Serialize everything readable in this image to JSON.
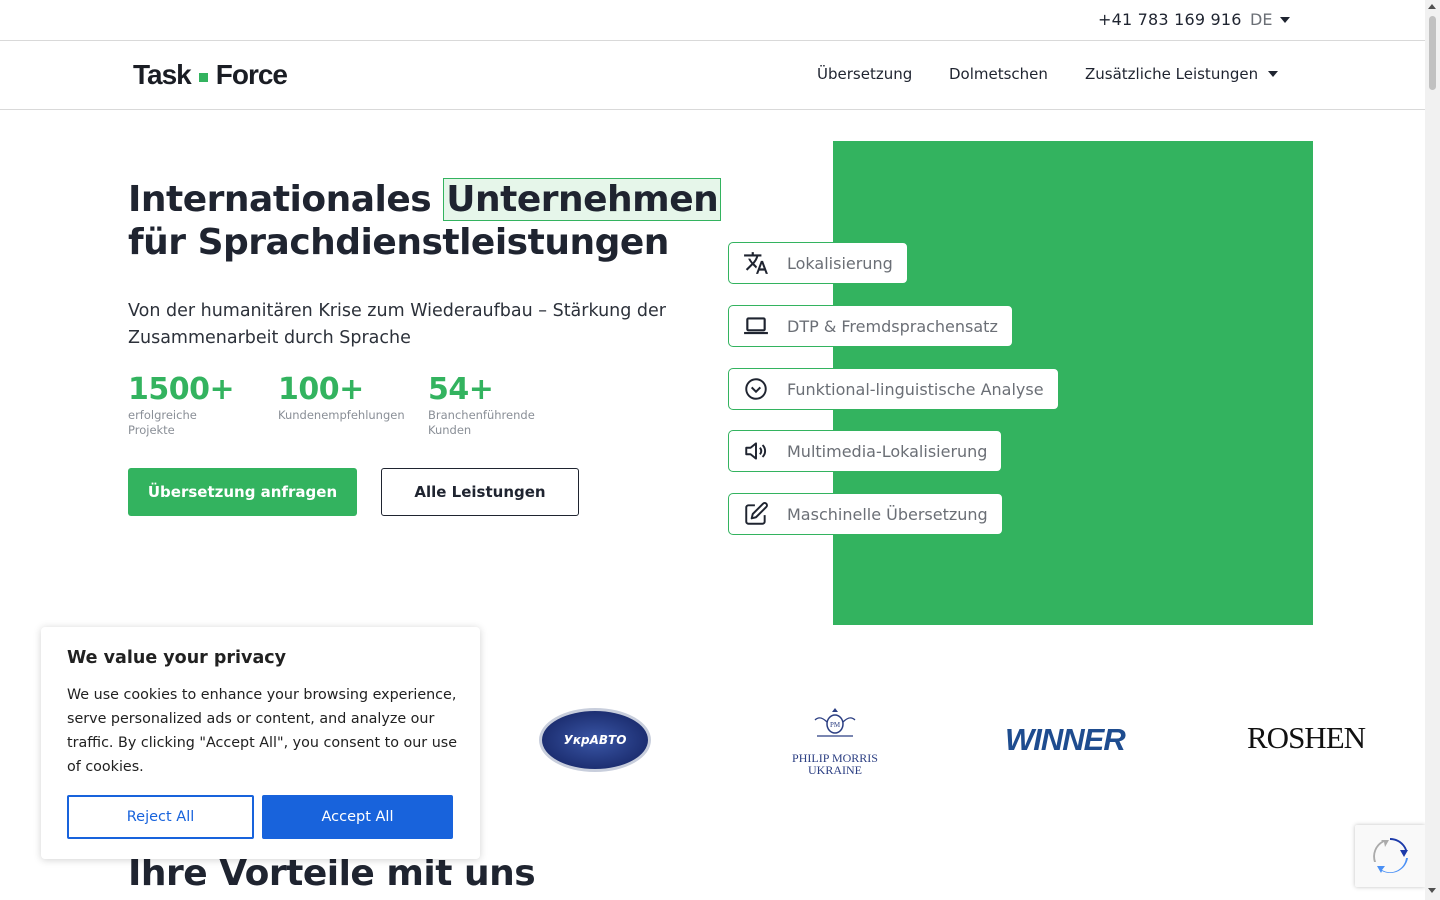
{
  "topbar": {
    "phone": "+41 783 169 916",
    "language": "DE"
  },
  "header": {
    "logo_left": "Task",
    "logo_right": "Force",
    "nav": [
      {
        "label": "Übersetzung"
      },
      {
        "label": "Dolmetschen"
      },
      {
        "label": "Zusätzliche Leistungen"
      }
    ]
  },
  "hero": {
    "title_part1": "Internationales",
    "title_highlight": "Unternehmen",
    "title_part2": "für Sprachdienstleistungen",
    "subtitle": "Von der humanitären Krise zum Wiederaufbau – Stärkung der Zusammenarbeit durch Sprache",
    "stats": [
      {
        "value": "1500+",
        "label": "erfolgreiche Projekte"
      },
      {
        "value": "100+",
        "label": "Kundenempfehlungen"
      },
      {
        "value": "54+",
        "label": "Branchenführende Kunden"
      }
    ],
    "primary_button": "Übersetzung anfragen",
    "secondary_button": "Alle Leistungen",
    "services": [
      {
        "label": "Lokalisierung",
        "icon": "translate-icon"
      },
      {
        "label": "DTP & Fremdsprachensatz",
        "icon": "laptop-icon"
      },
      {
        "label": "Funktional-linguistische Analyse",
        "icon": "chevron-circle-icon"
      },
      {
        "label": "Multimedia-Lokalisierung",
        "icon": "speaker-icon"
      },
      {
        "label": "Maschinelle Übersetzung",
        "icon": "edit-icon"
      }
    ],
    "accent_color": "#33b35f"
  },
  "clients": {
    "ukravto": "УкрАВТО",
    "philip_morris_line1": "PHILIP MORRIS",
    "philip_morris_line2": "UKRAINE",
    "winner": "WINNER",
    "roshen": "ROSHEN"
  },
  "section": {
    "title": "Ihre Vorteile mit uns"
  },
  "cookie": {
    "title": "We value your privacy",
    "text": "We use cookies to enhance your browsing experience, serve personalized ads or content, and analyze our traffic. By clicking \"Accept All\", you consent to our use of cookies.",
    "reject": "Reject All",
    "accept": "Accept All",
    "accent_color": "#1863dc"
  }
}
